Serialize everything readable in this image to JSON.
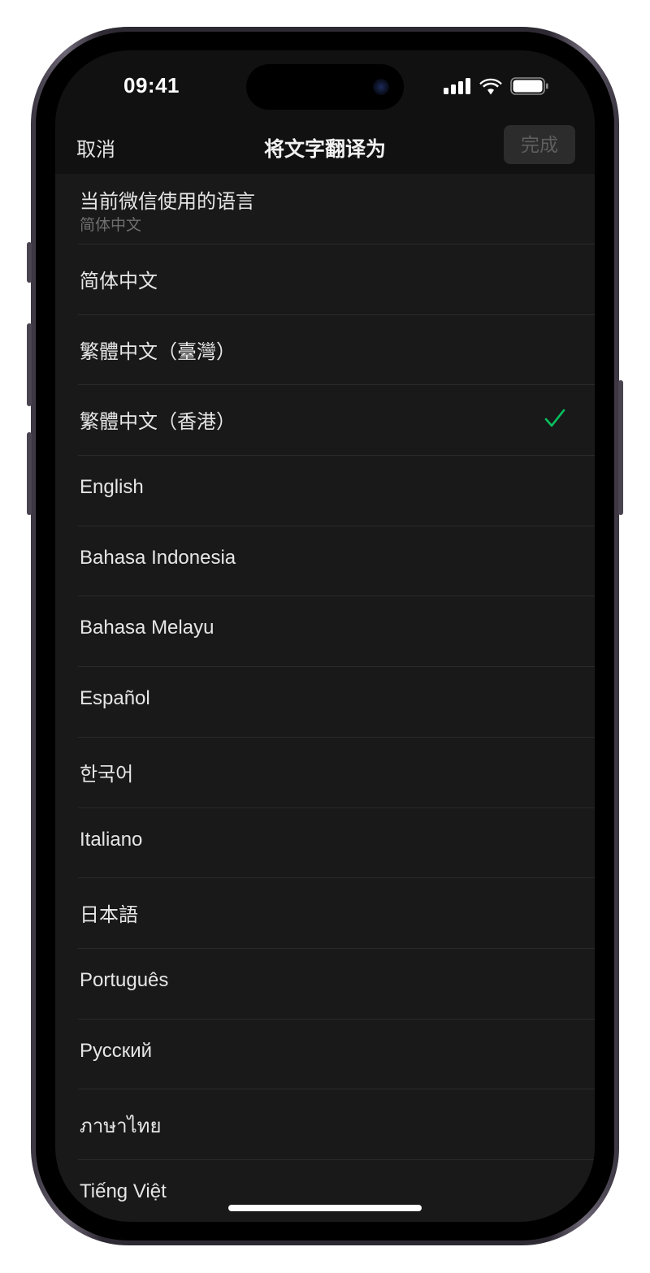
{
  "status_bar": {
    "time": "09:41",
    "icons": [
      "cellular-signal-icon",
      "wifi-icon",
      "battery-icon"
    ]
  },
  "nav": {
    "cancel_label": "取消",
    "title": "将文字翻译为",
    "done_label": "完成"
  },
  "current_language": {
    "title": "当前微信使用的语言",
    "value": "简体中文"
  },
  "languages": [
    {
      "label": "简体中文",
      "selected": false
    },
    {
      "label": "繁體中文（臺灣）",
      "selected": false
    },
    {
      "label": "繁體中文（香港）",
      "selected": true
    },
    {
      "label": "English",
      "selected": false
    },
    {
      "label": "Bahasa Indonesia",
      "selected": false
    },
    {
      "label": "Bahasa Melayu",
      "selected": false
    },
    {
      "label": "Español",
      "selected": false
    },
    {
      "label": "한국어",
      "selected": false
    },
    {
      "label": "Italiano",
      "selected": false
    },
    {
      "label": "日本語",
      "selected": false
    },
    {
      "label": "Português",
      "selected": false
    },
    {
      "label": "Русский",
      "selected": false
    },
    {
      "label": "ภาษาไทย",
      "selected": false
    },
    {
      "label": "Tiếng Việt",
      "selected": false
    }
  ],
  "colors": {
    "background": "#191919",
    "bar_background": "#111111",
    "text": "#e6e6e6",
    "secondary_text": "#6e6e6e",
    "check": "#07c160",
    "done_button_bg": "#2c2c2c",
    "done_button_text": "#5e5e5e"
  }
}
